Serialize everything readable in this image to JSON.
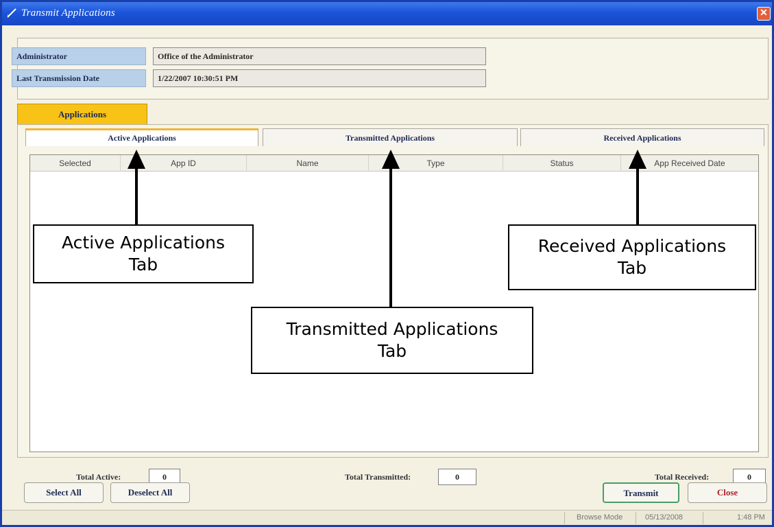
{
  "window": {
    "title": "Transmit Applications",
    "close_glyph": "✕",
    "icon": "pen-check-icon"
  },
  "info": {
    "admin_label": "Administrator",
    "admin_value": "Office of the Administrator",
    "last_tx_label": "Last Transmission Date",
    "last_tx_value": "1/22/2007 10:30:51 PM"
  },
  "outer_tab": {
    "label": "Applications"
  },
  "inner_tabs": [
    {
      "label": "Active Applications",
      "active": true
    },
    {
      "label": "Transmitted Applications",
      "active": false
    },
    {
      "label": "Received Applications",
      "active": false
    }
  ],
  "grid": {
    "columns": [
      "Selected",
      "App ID",
      "Name",
      "Type",
      "Status",
      "App Received Date"
    ],
    "rows": []
  },
  "totals": {
    "active_label": "Total Active:",
    "active_value": "0",
    "transmitted_label": "Total Transmitted:",
    "transmitted_value": "0",
    "received_label": "Total Received:",
    "received_value": "0"
  },
  "buttons": {
    "select_all": "Select All",
    "deselect_all": "Deselect All",
    "transmit": "Transmit",
    "close": "Close"
  },
  "status": {
    "mode": "Browse Mode",
    "date": "05/13/2008",
    "time": "1:48 PM"
  },
  "callouts": {
    "active_line1": "Active Applications",
    "active_line2": "Tab",
    "received_line1": "Received Applications",
    "received_line2": "Tab",
    "transmitted_line1": "Transmitted Applications",
    "transmitted_line2": "Tab"
  },
  "colors": {
    "titlebar": "#1b54d9",
    "tab_accent": "#f8c316",
    "label_bg": "#b8d0e8",
    "close_text": "#b2202c"
  }
}
